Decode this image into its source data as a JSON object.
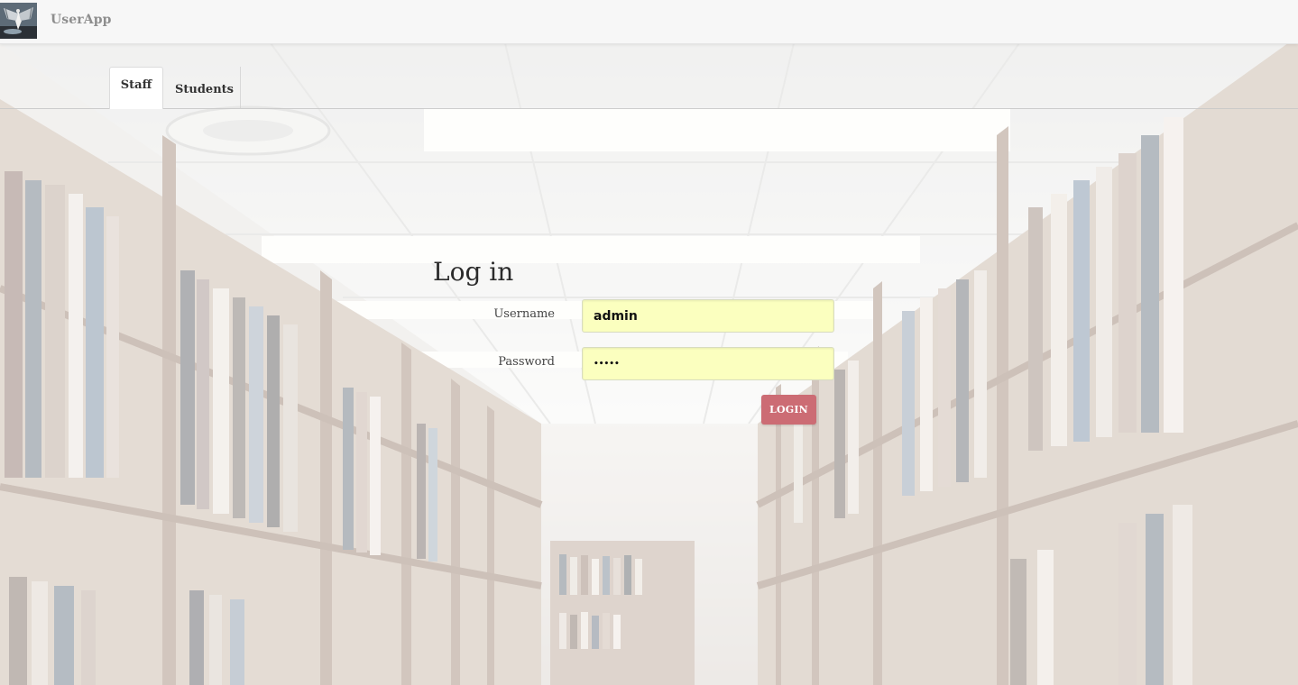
{
  "app": {
    "brand_name": "UserApp",
    "brand_logo_icon": "bat-photo-logo"
  },
  "tabs": [
    {
      "label": "Staff",
      "active": true
    },
    {
      "label": "Students",
      "active": false
    }
  ],
  "login": {
    "title": "Log in",
    "username_label": "Username",
    "username_value": "admin",
    "password_label": "Password",
    "password_value": "•••••",
    "submit_label": "LOGIN"
  },
  "colors": {
    "accent": "#cc6c74",
    "input_autofill": "#fbffbf",
    "navbar": "#f7f7f7"
  }
}
